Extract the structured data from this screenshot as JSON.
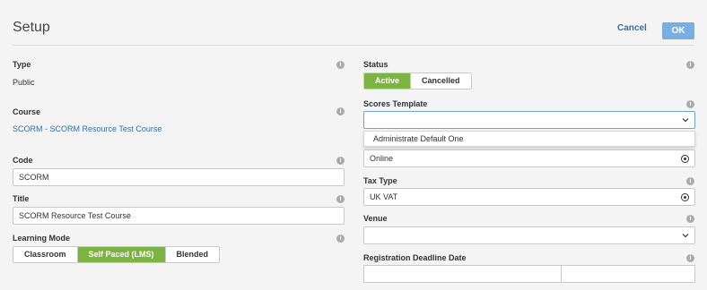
{
  "header": {
    "title": "Setup",
    "cancel_label": "Cancel",
    "ok_label": "OK"
  },
  "left": {
    "type": {
      "label": "Type",
      "value": "Public"
    },
    "course": {
      "label": "Course",
      "value": "SCORM - SCORM Resource Test Course"
    },
    "code": {
      "label": "Code",
      "value": "SCORM"
    },
    "title": {
      "label": "Title",
      "value": "SCORM Resource Test Course"
    },
    "learning_mode": {
      "label": "Learning Mode",
      "options": [
        "Classroom",
        "Self Paced (LMS)",
        "Blended"
      ],
      "selected": "Self Paced (LMS)"
    }
  },
  "right": {
    "status": {
      "label": "Status",
      "options": [
        "Active",
        "Cancelled"
      ],
      "selected": "Active"
    },
    "scores_template": {
      "label": "Scores Template",
      "value": "",
      "dropdown_option": "Administrate Default One"
    },
    "delivery": {
      "value": "Online"
    },
    "tax_type": {
      "label": "Tax Type",
      "value": "UK VAT"
    },
    "venue": {
      "label": "Venue",
      "value": ""
    },
    "registration_deadline": {
      "label": "Registration Deadline Date"
    }
  },
  "colors": {
    "accent_green": "#7cb342",
    "link_blue": "#2f6fa8",
    "ok_button": "#78aee0"
  },
  "icons": {
    "info": "info-icon",
    "chevron": "chevron-down-icon",
    "target": "target-icon"
  }
}
